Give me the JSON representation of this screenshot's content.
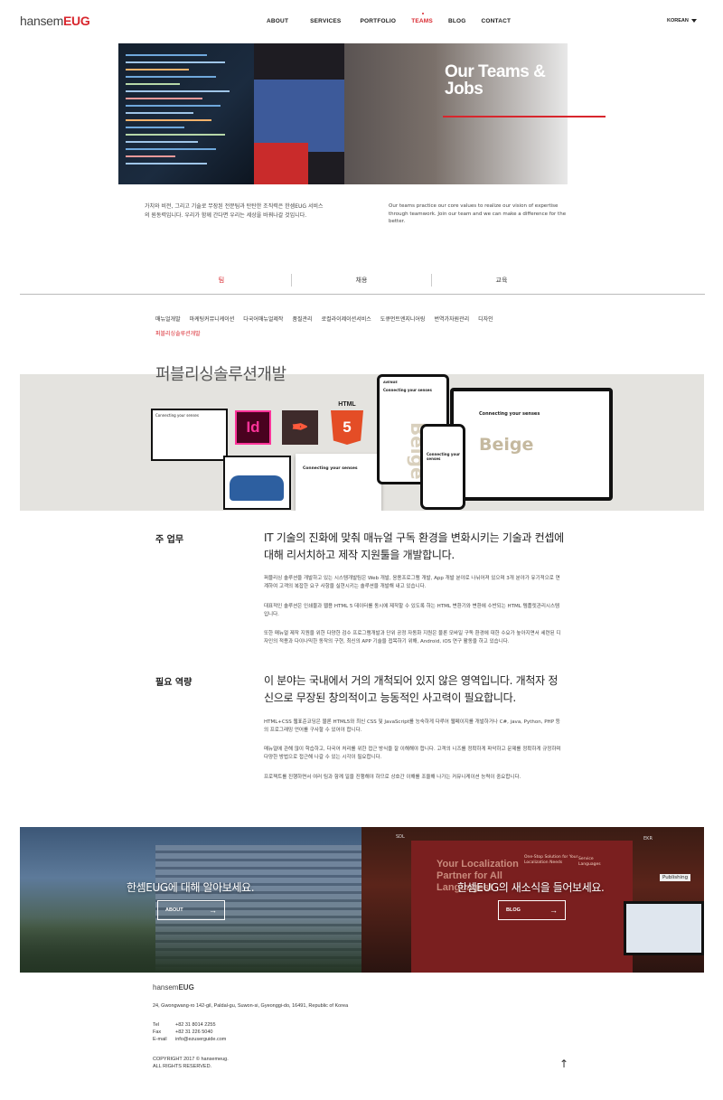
{
  "header": {
    "logo_light": "hansem",
    "logo_bold": "EUG",
    "nav": [
      "ABOUT",
      "SERVICES",
      "PORTFOLIO",
      "TEAMS",
      "BLOG",
      "CONTACT"
    ],
    "language": "KOREAN"
  },
  "hero": {
    "title_line1": "Our Teams &",
    "title_line2": "Jobs"
  },
  "intro": {
    "ko": "가치와 비전, 그리고 기술로 무장된 전문팀과 탄탄한 조직력은 한셈EUG 서비스의 원동력입니다. 우리가 함께 간다면 우리는 세상을 바꿔나갈 것입니다.",
    "en": "Our teams practice our core values to realize our vision of expertise through teamwork. Join our team and we can make a difference for the better."
  },
  "tabs": [
    "팀",
    "채용",
    "교육"
  ],
  "subnav": [
    "매뉴얼개발",
    "마케팅커뮤니케이션",
    "다국어매뉴얼제작",
    "품질관리",
    "로컬라이제이션서비스",
    "도큐먼트엔지니어링",
    "번역가자원관리",
    "디자인",
    "퍼블리싱솔루션개발"
  ],
  "banner": {
    "title": "퍼블리싱솔루션개발",
    "icon_id": "Id",
    "icon_html": "HTML",
    "icon_five": "5",
    "mock_heading": "Connecting your senses",
    "mock_word": "Beige",
    "mock_brand": "AVENUE",
    "colors": {
      "indesign": "#49021f",
      "indesign_text": "#ff3399",
      "acrobat": "#3e2b2b",
      "html5": "#e44d26"
    }
  },
  "section1": {
    "label": "주 업무",
    "lead": "IT 기술의 진화에 맞춰 매뉴얼 구독 환경을 변화시키는 기술과 컨셉에 대해 리서치하고 제작 지원툴을 개발합니다.",
    "p1": "퍼블리싱 솔루션을 개발하고 있는 시스템개발팀은 Web 개발, 응용프로그램 개발, App 개발 분야로 나뉘어져 있으며 3개 분야가 유기적으로 연계하여 고객의 복잡한 요구 사항을 실현시키는 솔루션을 개발해 내고 있습니다.",
    "p2": "대표적인 솔루션은 인쇄물과 웹용 HTML 5 데이터를 동시에 제작할 수 있도록 하는 HTML 변환기와 변환에 수반되는 HTML 템플릿관리시스템입니다.",
    "p3": "또한 매뉴얼 제작 지원을 위한 다양한 검수 프로그램개발과 단위 공정 자동화 지원은 물론 모바일 구독 환경에 대한 수요가 높아지면서 세련된 디자인의 적용과 다이나믹한 동작의 구현, 최신의 APP 기술을 접목하기 위해, Android, iOS 연구 활동을 하고 있습니다."
  },
  "section2": {
    "label": "필요 역량",
    "lead": "이 분야는 국내에서 거의 개척되어 있지 않은 영역입니다. 개척자 정신으로 무장된 창의적이고 능동적인 사고력이 필요합니다.",
    "p1": "HTML+CSS 웹표준코딩은 물론 HTML5와 최신 CSS 및 JavaScript를 능숙하게 다루어 웹페이지를 개발하거나 C#, java, Python, PHP 등의 프로그래밍 언어를 구사할 수 있어야 합니다.",
    "p2": "매뉴얼에 관해 많이 학습하고, 다국어 처리를 위한 접근 방식을 잘 이해해야 합니다. 고객의 니즈를 정확하게 파악하고 문제를 정확하게 규정하며 다양한 방법으로 접근해 나갈 수 있는 시각이 필요합니다.",
    "p3": "프로젝트를 진행하면서 여러 팀과 함께 일을 진행해야 하므로 상호간 이해를 조율해 나가는 커뮤니케이션 능력이 중요합니다."
  },
  "panels": {
    "left_text": "한셈EUG에 대해 알아보세요.",
    "left_button": "ABOUT",
    "right_text": "한셈EUG의 새소식을 들어보세요.",
    "right_button": "BLOG",
    "booth_big": "Your Localization Partner for All Languages!",
    "booth_small": "One-Stop Solution for Your Localization Needs",
    "booth_service": "Service Languages",
    "booth_publishing": "Publishing",
    "booth_sdl": "SDL",
    "booth_ekr": "EKR"
  },
  "footer": {
    "logo_light": "hansem",
    "logo_bold": "EUG",
    "address": "24, Gwongwang-ro 142-gil, Paldal-gu, Suwon-si, Gyeonggi-do, 16491, Republic of Korea",
    "tel_label": "Tel",
    "tel": "+82 31 8014 2255",
    "fax_label": "Fax",
    "fax": "+82 31 226 5040",
    "email_label": "E-mail",
    "email": "info@ezuserguide.com",
    "copyright": "COPYRIGHT 2017 © hansemeug.",
    "rights": "ALL RIGHTS RESERVED.",
    "top_arrow": "↑"
  }
}
